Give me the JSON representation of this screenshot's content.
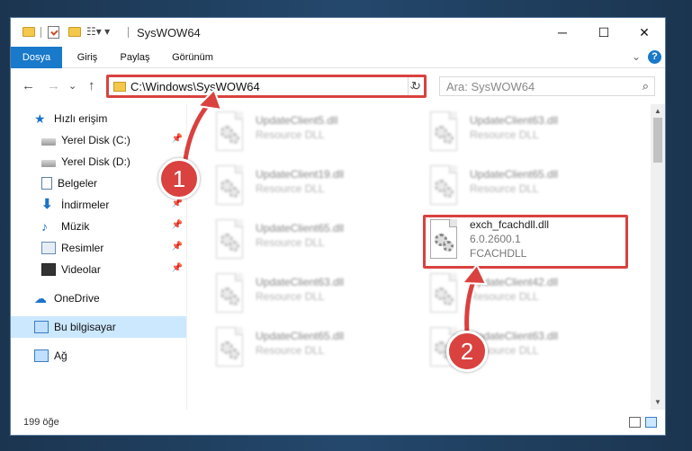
{
  "window": {
    "title": "SysWOW64",
    "min_glyph": "─",
    "max_glyph": "☐",
    "close_glyph": "✕"
  },
  "ribbon": {
    "tabs": [
      "Dosya",
      "Giriş",
      "Paylaş",
      "Görünüm"
    ],
    "expand_glyph": "⌄",
    "help_glyph": "?"
  },
  "nav": {
    "back_glyph": "←",
    "forward_glyph": "→",
    "recent_glyph": "⌄",
    "up_glyph": "↑",
    "address": "C:\\Windows\\SysWOW64",
    "refresh_glyph": "↻",
    "search_placeholder": "Ara: SysWOW64"
  },
  "sidebar": {
    "items": [
      {
        "label": "Hızlı erişim",
        "icon": "star-icon"
      },
      {
        "label": "Yerel Disk (C:)",
        "icon": "drive-icon",
        "pinned": true
      },
      {
        "label": "Yerel Disk (D:)",
        "icon": "drive-icon"
      },
      {
        "label": "Belgeler",
        "icon": "documents-icon",
        "pinned": true
      },
      {
        "label": "İndirmeler",
        "icon": "download-icon",
        "pinned": true
      },
      {
        "label": "Müzik",
        "icon": "music-icon",
        "pinned": true
      },
      {
        "label": "Resimler",
        "icon": "pictures-icon",
        "pinned": true
      },
      {
        "label": "Videolar",
        "icon": "videos-icon",
        "pinned": true
      },
      {
        "label": "OneDrive",
        "icon": "cloud-icon"
      },
      {
        "label": "Bu bilgisayar",
        "icon": "computer-icon",
        "selected": true
      },
      {
        "label": "Ağ",
        "icon": "network-icon"
      }
    ]
  },
  "files": [
    {
      "name": "UpdateClient5.dll",
      "desc": "Resource DLL",
      "blurred": true
    },
    {
      "name": "UpdateClient63.dll",
      "desc": "Resource DLL",
      "blurred": true
    },
    {
      "name": "UpdateClient19.dll",
      "desc": "Resource DLL",
      "blurred": true
    },
    {
      "name": "UpdateClient65.dll",
      "desc": "Resource DLL",
      "blurred": true
    },
    {
      "name": "UpdateClient65.dll",
      "desc": "Resource DLL",
      "blurred": true
    },
    {
      "name": "exch_fcachdll.dll",
      "version": "6.0.2600.1",
      "desc": "FCACHDLL",
      "blurred": false
    },
    {
      "name": "UpdateClient63.dll",
      "desc": "Resource DLL",
      "blurred": true
    },
    {
      "name": "UpdateClient42.dll",
      "desc": "Resource DLL",
      "blurred": true
    },
    {
      "name": "UpdateClient65.dll",
      "desc": "Resource DLL",
      "blurred": true
    },
    {
      "name": "UpdateClient63.dll",
      "desc": "Resource DLL",
      "blurred": true
    }
  ],
  "status": {
    "item_count": "199 öğe"
  },
  "callouts": {
    "one": "1",
    "two": "2"
  },
  "colors": {
    "accent": "#1979ca",
    "highlight": "#d9423f",
    "selected": "#cce8ff"
  }
}
